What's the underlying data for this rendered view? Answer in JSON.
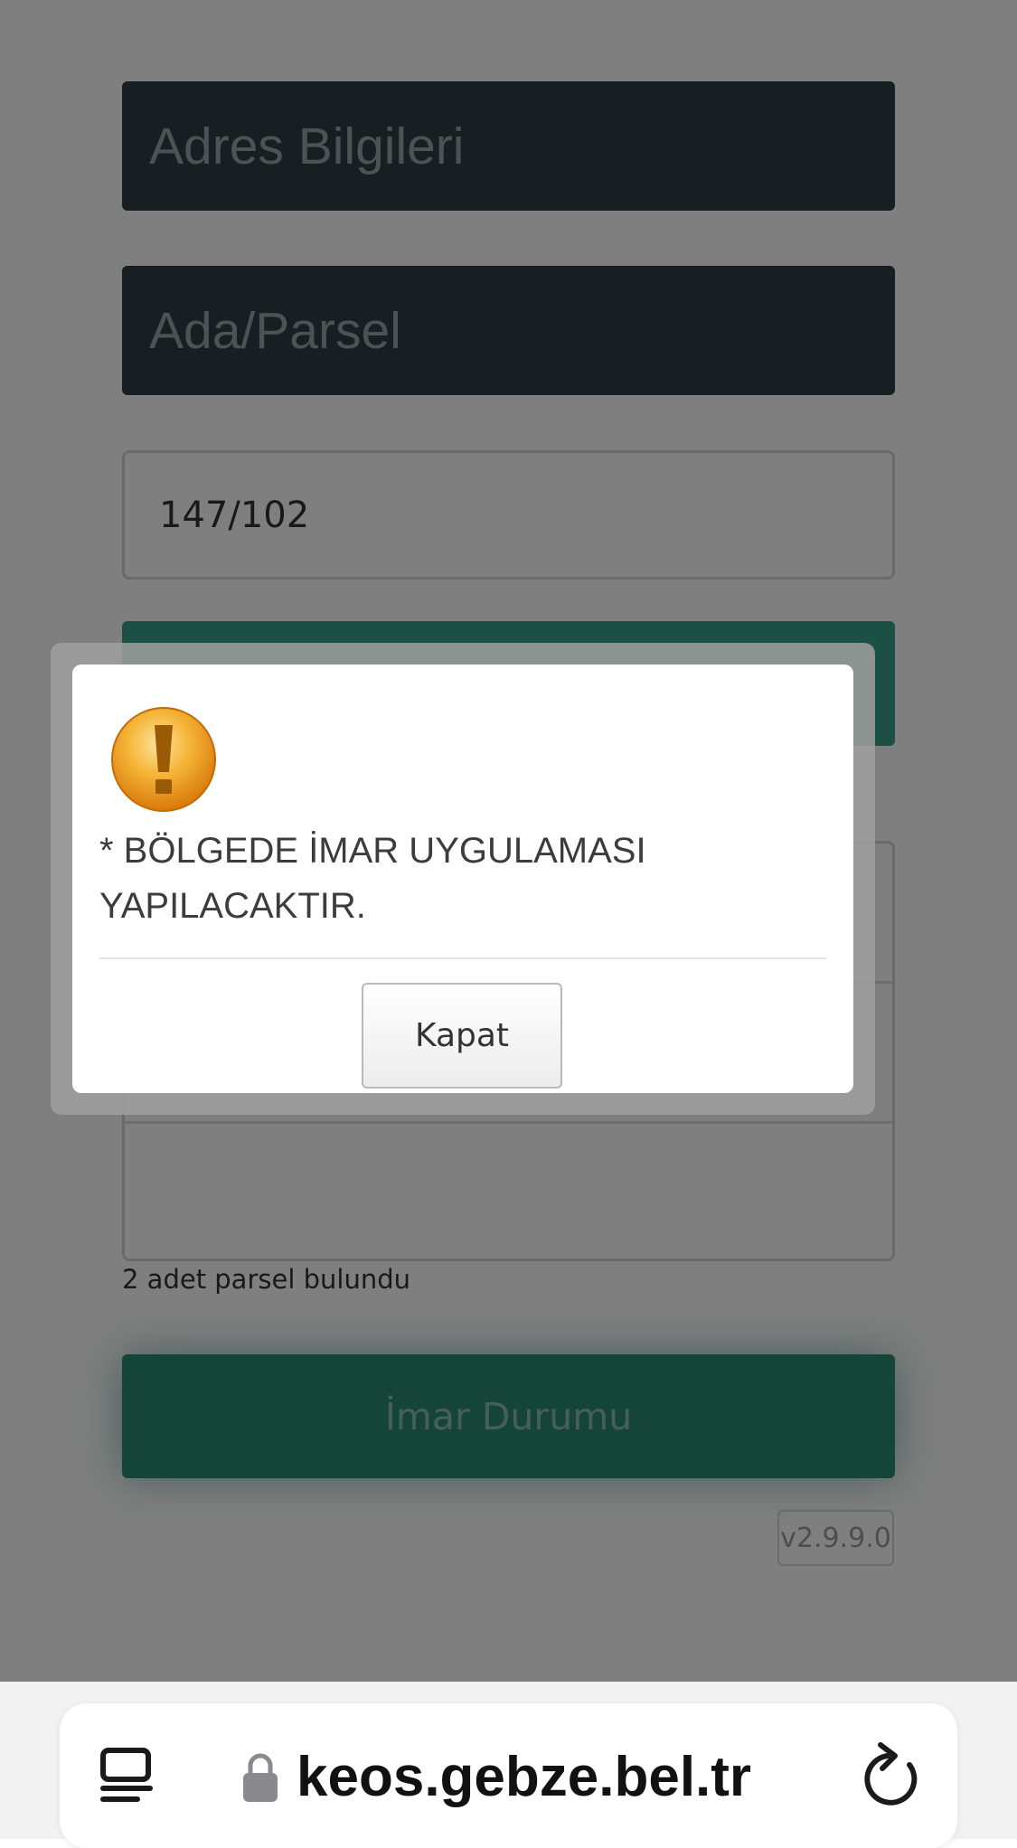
{
  "form": {
    "address_header": "Adres Bilgileri",
    "parcel_header": "Ada/Parsel",
    "parcel_value": "147/102",
    "result_count": "2 adet parsel bulundu",
    "imar_button_label": "İmar Durumu",
    "version": "v2.9.9.0"
  },
  "dialog": {
    "icon": "warning-icon",
    "message": "* BÖLGEDE İMAR UYGULAMASI YAPILACAKTIR.",
    "close_label": "Kapat"
  },
  "browser": {
    "url": "keos.gebze.bel.tr",
    "icons": [
      "reader-icon",
      "lock-icon",
      "reload-icon"
    ]
  },
  "colors": {
    "header_bg": "#2e3e46",
    "accent_green": "#3aa189",
    "imar_button": "#2a8873",
    "warning_orange": "#f2a20f"
  }
}
